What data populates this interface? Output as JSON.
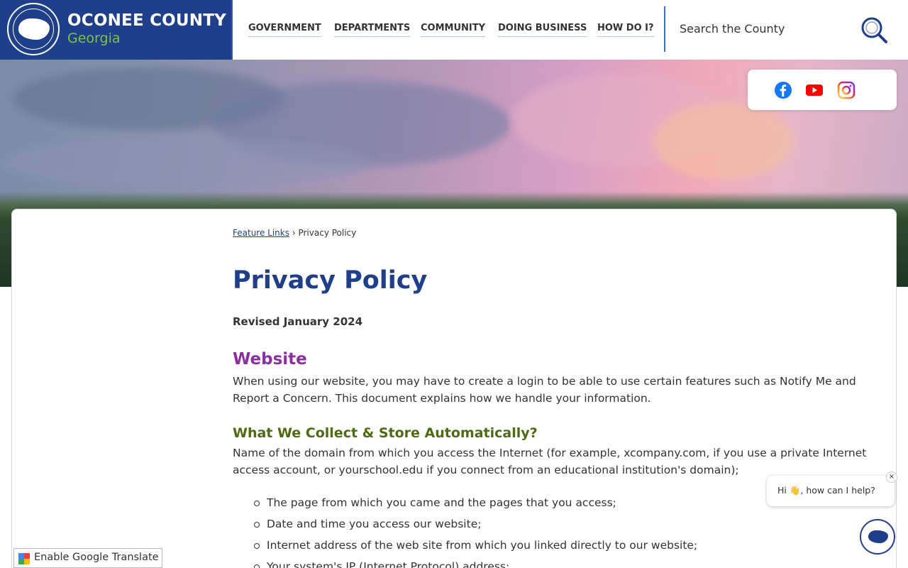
{
  "brand": {
    "title": "OCONEE COUNTY",
    "subtitle": "Georgia"
  },
  "nav": {
    "items": [
      "GOVERNMENT",
      "DEPARTMENTS",
      "COMMUNITY",
      "DOING BUSINESS",
      "HOW DO I?"
    ]
  },
  "search": {
    "placeholder": "Search the County"
  },
  "social": [
    "facebook-icon",
    "youtube-icon",
    "instagram-icon"
  ],
  "breadcrumb": {
    "link": "Feature Links",
    "separator": "›",
    "current": "Privacy Policy"
  },
  "page": {
    "title": "Privacy Policy",
    "revised": "Revised January 2024",
    "section1_heading": "Website",
    "section1_text": "When using our website, you may have to create a login to be able to use certain features such as Notify Me and Report a Concern. This document explains how we handle your information.",
    "section2_heading": "What We Collect & Store Automatically?",
    "section2_text": "Name of the domain from which you access the Internet (for example, xcompany.com, if you use a private Internet access account, or yourschool.edu if you connect from an educational institution's domain);",
    "list": [
      "The page from which you came and the pages that you access;",
      "Date and time you access our website;",
      "Internet address of the web site from which you linked directly to our website;",
      "Your system's IP (Internet Protocol) address;"
    ]
  },
  "chat": {
    "greeting": "Hi 👋, how can I help?",
    "close": "×"
  },
  "translate": {
    "label": "Enable Google Translate"
  },
  "colors": {
    "brand_blue": "#1f3f8a",
    "brand_green": "#7dc242",
    "heading_purple": "#8b2fa0",
    "heading_green": "#4f6b12"
  }
}
